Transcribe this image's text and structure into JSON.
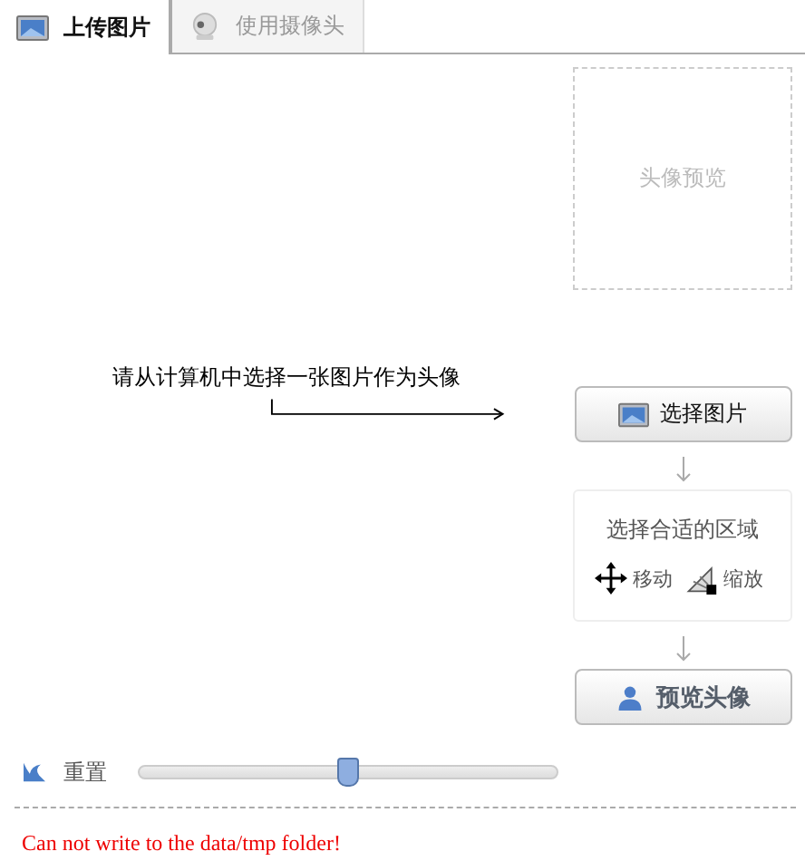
{
  "tabs": [
    {
      "label": "上传图片",
      "selected": true,
      "kind": "picture"
    },
    {
      "label": "使用摄像头",
      "selected": false,
      "kind": "webcam"
    }
  ],
  "preview_box": {
    "caption": "头像预览"
  },
  "instruction": "请从计算机中选择一张图片作为头像",
  "choose_button": "选择图片",
  "crop_hint": {
    "title": "选择合适的区域",
    "move": "移动",
    "scale": "缩放"
  },
  "preview_button": "预览头像",
  "reset": "重置",
  "zoom_slider": {
    "level": 0.5
  },
  "error": "Can not write to the data/tmp folder!"
}
